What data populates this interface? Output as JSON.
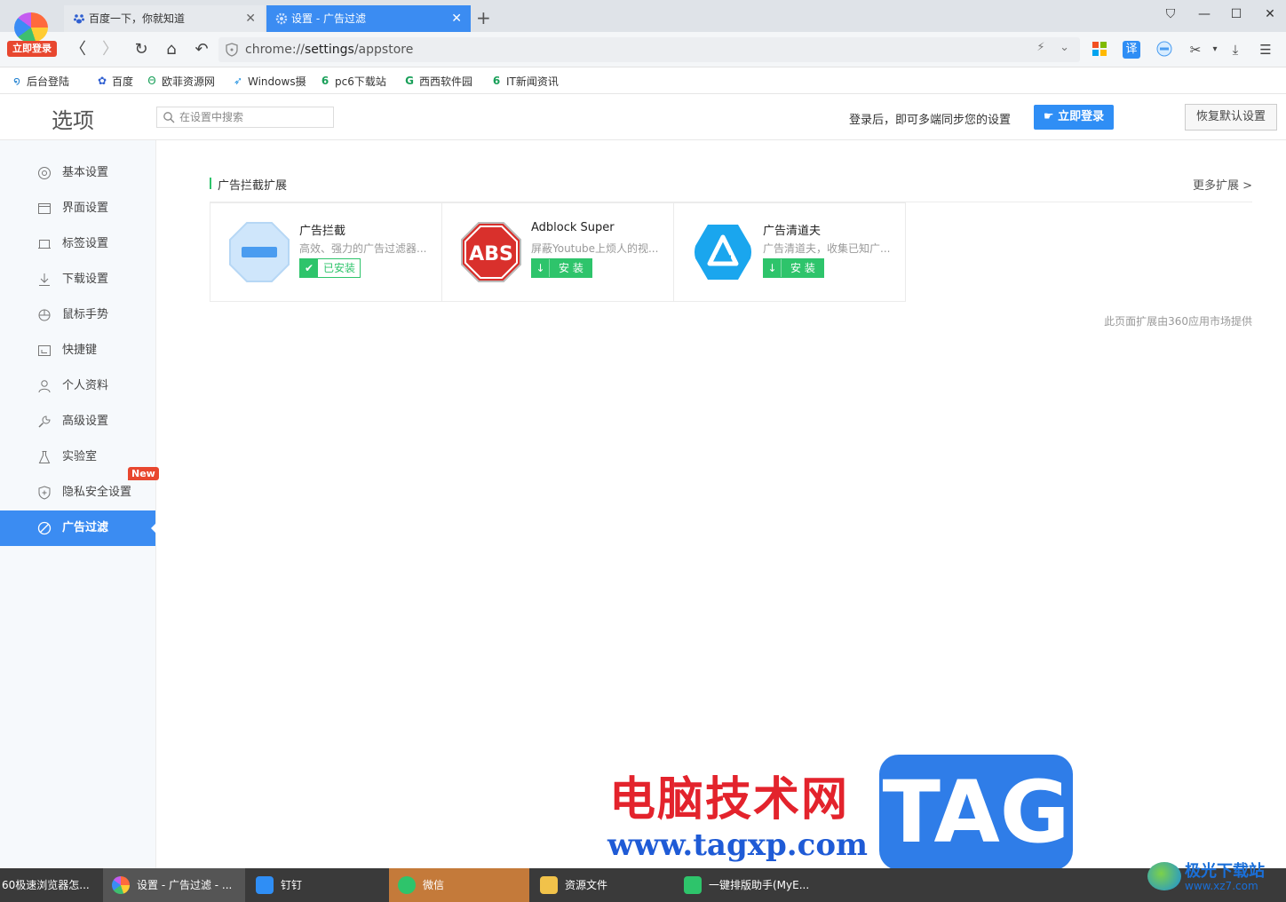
{
  "browser": {
    "login_badge": "立即登录",
    "tabs": [
      {
        "label": "百度一下，你就知道",
        "icon": "baidu-paw-icon"
      },
      {
        "label": "设置 - 广告过滤",
        "icon": "gear-icon"
      }
    ],
    "new_tab": "+",
    "address": {
      "scheme": "chrome://",
      "host": "settings",
      "path": "/appstore"
    },
    "translate_label": "译"
  },
  "bookmarks": [
    {
      "label": "后台登陆",
      "icon": "swirl-icon"
    },
    {
      "label": "百度",
      "icon": "baidu-paw-icon"
    },
    {
      "label": "欧菲资源网",
      "icon": "ofi-icon"
    },
    {
      "label": "Windows摄",
      "icon": "bird-icon"
    },
    {
      "label": "pc6下载站",
      "icon": "pc6-icon"
    },
    {
      "label": "西西软件园",
      "icon": "cici-icon"
    },
    {
      "label": "IT新闻资讯",
      "icon": "pc6-icon"
    }
  ],
  "settings": {
    "title": "选项",
    "search_placeholder": "在设置中搜索",
    "sync_text": "登录后，即可多端同步您的设置",
    "login_button": "立即登录",
    "reset_button": "恢复默认设置"
  },
  "sidebar": {
    "items": [
      {
        "label": "基本设置",
        "icon": "settings-circle-icon"
      },
      {
        "label": "界面设置",
        "icon": "window-icon"
      },
      {
        "label": "标签设置",
        "icon": "tab-icon"
      },
      {
        "label": "下载设置",
        "icon": "download-icon"
      },
      {
        "label": "鼠标手势",
        "icon": "mouse-icon"
      },
      {
        "label": "快捷键",
        "icon": "keyboard-icon"
      },
      {
        "label": "个人资料",
        "icon": "person-icon"
      },
      {
        "label": "高级设置",
        "icon": "wrench-icon"
      },
      {
        "label": "实验室",
        "icon": "flask-icon"
      },
      {
        "label": "隐私安全设置",
        "icon": "shield-plus-icon"
      },
      {
        "label": "广告过滤",
        "icon": "block-icon"
      }
    ],
    "new_badge": "New"
  },
  "main": {
    "section_title": "广告拦截扩展",
    "more_link": "更多扩展 >",
    "extensions": [
      {
        "name": "广告拦截",
        "desc": "高效、强力的广告过滤器...",
        "button": "已安装",
        "state": "installed"
      },
      {
        "name": "Adblock Super",
        "desc": "屏蔽Youtube上烦人的视...",
        "button": "安 装",
        "state": "install"
      },
      {
        "name": "广告清道夫",
        "desc": "广告清道夫，收集已知广...",
        "button": "安 装",
        "state": "install"
      }
    ],
    "abs_logo_text": "ABS",
    "provider_note": "此页面扩展由360应用市场提供"
  },
  "watermark": {
    "cn_text": "电脑技术网",
    "url": "www.tagxp.com",
    "tag": "TAG",
    "xz_title": "极光下载站",
    "xz_url": "www.xz7.com"
  },
  "taskbar": [
    {
      "label": "60极速浏览器怎..."
    },
    {
      "label": "设置 - 广告过滤 - ..."
    },
    {
      "label": "钉钉"
    },
    {
      "label": "微信"
    },
    {
      "label": "资源文件"
    },
    {
      "label": "一键排版助手(MyE..."
    }
  ]
}
